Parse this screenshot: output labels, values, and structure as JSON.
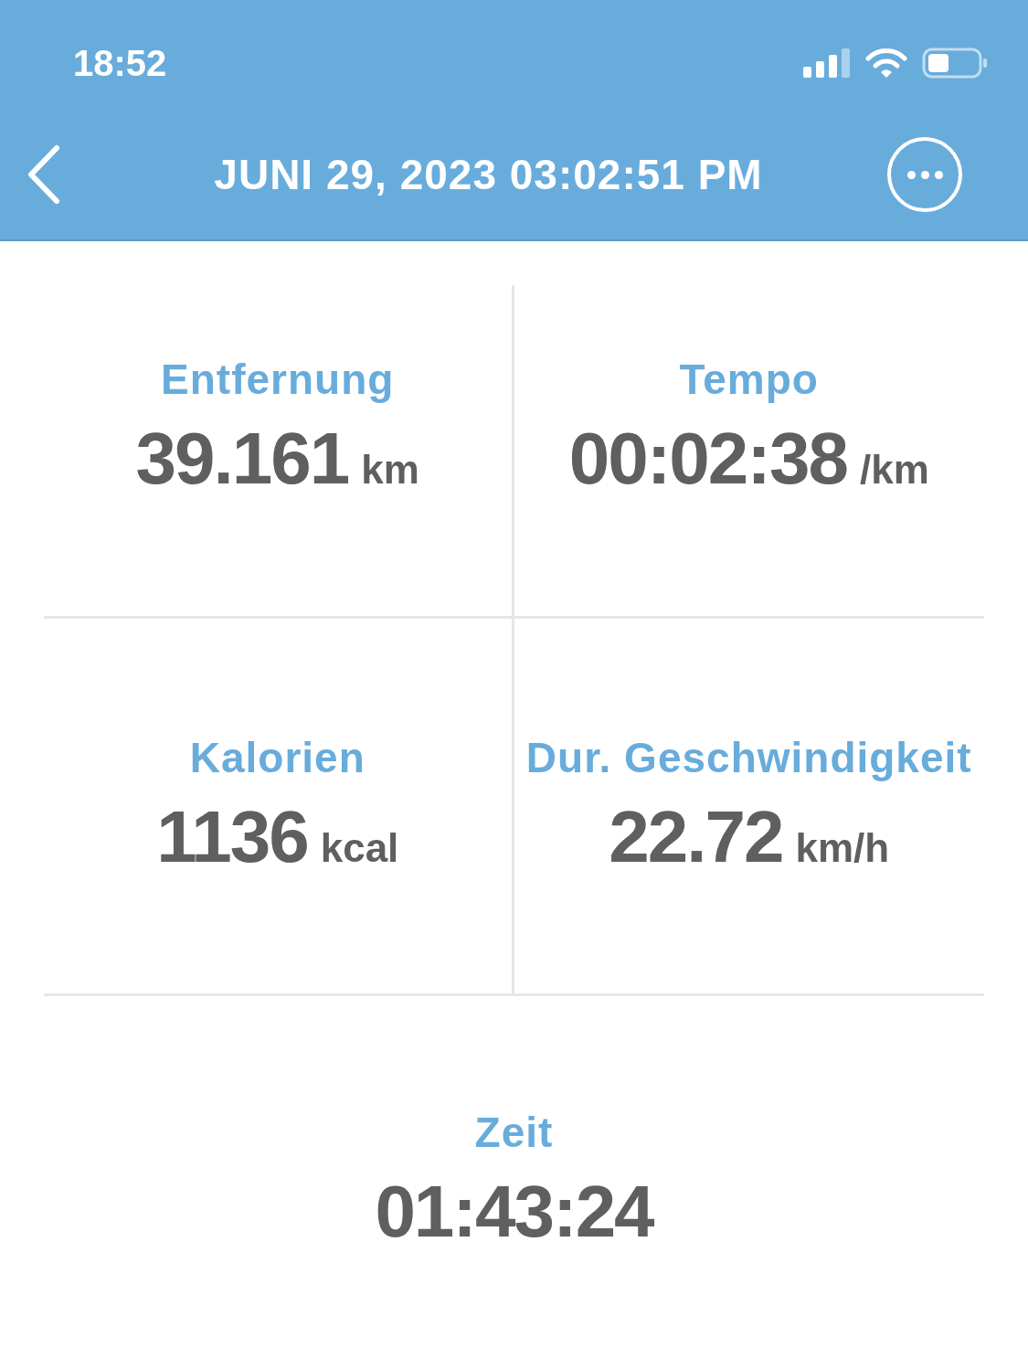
{
  "status_bar": {
    "time": "18:52"
  },
  "header": {
    "title": "JUNI 29, 2023 03:02:51 PM"
  },
  "stats": [
    {
      "label": "Entfernung",
      "value": "39.161",
      "unit": "km"
    },
    {
      "label": "Tempo",
      "value": "00:02:38",
      "unit": "/km"
    },
    {
      "label": "Kalorien",
      "value": "1136",
      "unit": "kcal"
    },
    {
      "label": "Dur. Geschwindigkeit",
      "value": "22.72",
      "unit": "km/h"
    }
  ],
  "total": {
    "label": "Zeit",
    "value": "01:43:24"
  }
}
